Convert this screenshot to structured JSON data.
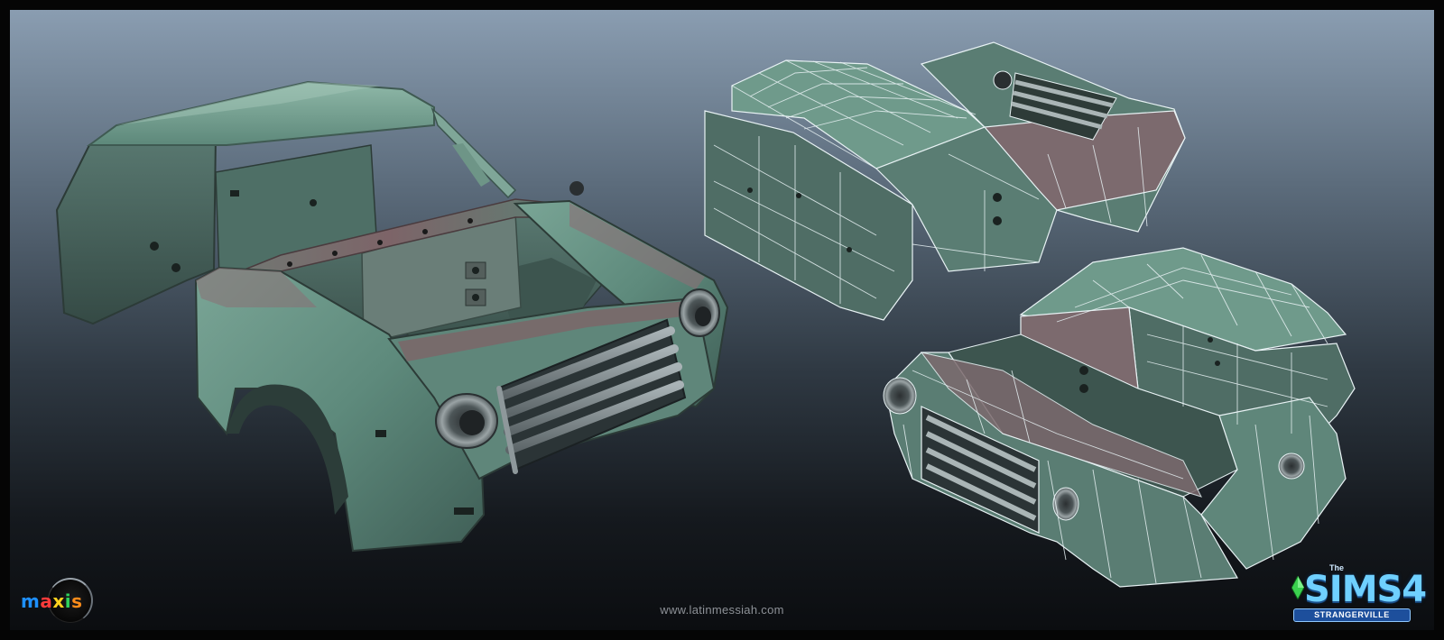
{
  "footer": {
    "website": "www.latinmessiah.com"
  },
  "logos": {
    "maxis": "maxis",
    "sims_the": "The",
    "sims_title": "SIMS4",
    "sims_subtitle": "STRANGERVILLE"
  },
  "colors": {
    "paint_green": "#5e8a7c",
    "paint_green_light": "#8fb8a8",
    "rust": "#7d6468",
    "interior": "#4f6e66",
    "wire": "#e8f2f4",
    "background_top": "#8a9db1",
    "background_bottom": "#0b0d10"
  }
}
